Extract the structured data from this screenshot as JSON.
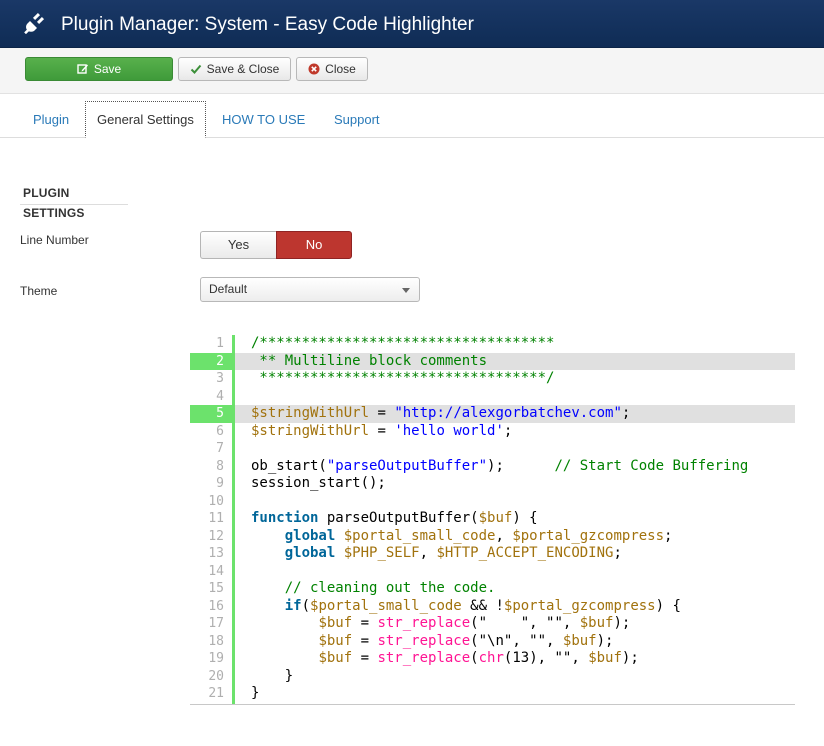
{
  "header": {
    "title": "Plugin Manager: System - Easy Code Highlighter",
    "icon": "plug-icon"
  },
  "toolbar": {
    "save": "Save",
    "save_close": "Save & Close",
    "close": "Close"
  },
  "tabs": [
    "Plugin",
    "General Settings",
    "HOW TO USE",
    "Support"
  ],
  "active_tab": "General Settings",
  "section_title": "PLUGIN SETTINGS",
  "fields": {
    "line_number": {
      "label": "Line Number",
      "options": [
        "Yes",
        "No"
      ],
      "selected": "No"
    },
    "theme": {
      "label": "Theme",
      "value": "Default"
    }
  },
  "colors": {
    "header": "#17355f",
    "save": "#48a444",
    "no_active": "#bd362f",
    "gutter": "#6ce26c",
    "highlight": "#e0e0e0",
    "link": "#2a7ab8"
  },
  "code": {
    "highlighted_lines": [
      2,
      5
    ],
    "lines": [
      {
        "n": "1",
        "t": [
          [
            "c",
            "/***********************************"
          ]
        ]
      },
      {
        "n": "2",
        "t": [
          [
            "c",
            " ** Multiline block comments"
          ]
        ]
      },
      {
        "n": "3",
        "t": [
          [
            "c",
            " **********************************/"
          ]
        ]
      },
      {
        "n": "4",
        "t": []
      },
      {
        "n": "5",
        "t": [
          [
            "v",
            "$stringWithUrl"
          ],
          [
            "p",
            " = "
          ],
          [
            "s",
            "\"http://alexgorbatchev.com\""
          ],
          [
            "p",
            ";"
          ]
        ]
      },
      {
        "n": "6",
        "t": [
          [
            "v",
            "$stringWithUrl"
          ],
          [
            "p",
            " = "
          ],
          [
            "s",
            "'hello world'"
          ],
          [
            "p",
            ";"
          ]
        ]
      },
      {
        "n": "7",
        "t": []
      },
      {
        "n": "8",
        "t": [
          [
            "p",
            "ob_start("
          ],
          [
            "s",
            "\"parseOutputBuffer\""
          ],
          [
            "p",
            ");      "
          ],
          [
            "c",
            "// Start Code Buffering"
          ]
        ]
      },
      {
        "n": "9",
        "t": [
          [
            "p",
            "session_start();"
          ]
        ]
      },
      {
        "n": "10",
        "t": []
      },
      {
        "n": "11",
        "t": [
          [
            "k",
            "function"
          ],
          [
            "p",
            " parseOutputBuffer("
          ],
          [
            "v",
            "$buf"
          ],
          [
            "p",
            ") {"
          ]
        ]
      },
      {
        "n": "12",
        "t": [
          [
            "p",
            "    "
          ],
          [
            "k",
            "global"
          ],
          [
            "p",
            " "
          ],
          [
            "v",
            "$portal_small_code"
          ],
          [
            "p",
            ", "
          ],
          [
            "v",
            "$portal_gzcompress"
          ],
          [
            "p",
            ";"
          ]
        ]
      },
      {
        "n": "13",
        "t": [
          [
            "p",
            "    "
          ],
          [
            "k",
            "global"
          ],
          [
            "p",
            " "
          ],
          [
            "v",
            "$PHP_SELF"
          ],
          [
            "p",
            ", "
          ],
          [
            "v",
            "$HTTP_ACCEPT_ENCODING"
          ],
          [
            "p",
            ";"
          ]
        ]
      },
      {
        "n": "14",
        "t": []
      },
      {
        "n": "15",
        "t": [
          [
            "p",
            "    "
          ],
          [
            "c",
            "// cleaning out the code."
          ]
        ]
      },
      {
        "n": "16",
        "t": [
          [
            "p",
            "    "
          ],
          [
            "k",
            "if"
          ],
          [
            "p",
            "("
          ],
          [
            "v",
            "$portal_small_code"
          ],
          [
            "p",
            " && !"
          ],
          [
            "v",
            "$portal_gzcompress"
          ],
          [
            "p",
            ") {"
          ]
        ]
      },
      {
        "n": "17",
        "t": [
          [
            "p",
            "        "
          ],
          [
            "v",
            "$buf"
          ],
          [
            "p",
            " = "
          ],
          [
            "f",
            "str_replace"
          ],
          [
            "p",
            "(\"    \", \"\", "
          ],
          [
            "v",
            "$buf"
          ],
          [
            "p",
            ");"
          ]
        ]
      },
      {
        "n": "18",
        "t": [
          [
            "p",
            "        "
          ],
          [
            "v",
            "$buf"
          ],
          [
            "p",
            " = "
          ],
          [
            "f",
            "str_replace"
          ],
          [
            "p",
            "(\"\\n\", \"\", "
          ],
          [
            "v",
            "$buf"
          ],
          [
            "p",
            ");"
          ]
        ]
      },
      {
        "n": "19",
        "t": [
          [
            "p",
            "        "
          ],
          [
            "v",
            "$buf"
          ],
          [
            "p",
            " = "
          ],
          [
            "f",
            "str_replace"
          ],
          [
            "p",
            "("
          ],
          [
            "f",
            "chr"
          ],
          [
            "p",
            "(13), \"\", "
          ],
          [
            "v",
            "$buf"
          ],
          [
            "p",
            ");"
          ]
        ]
      },
      {
        "n": "20",
        "t": [
          [
            "p",
            "    }"
          ]
        ]
      },
      {
        "n": "21",
        "t": [
          [
            "p",
            "}"
          ]
        ]
      }
    ]
  }
}
